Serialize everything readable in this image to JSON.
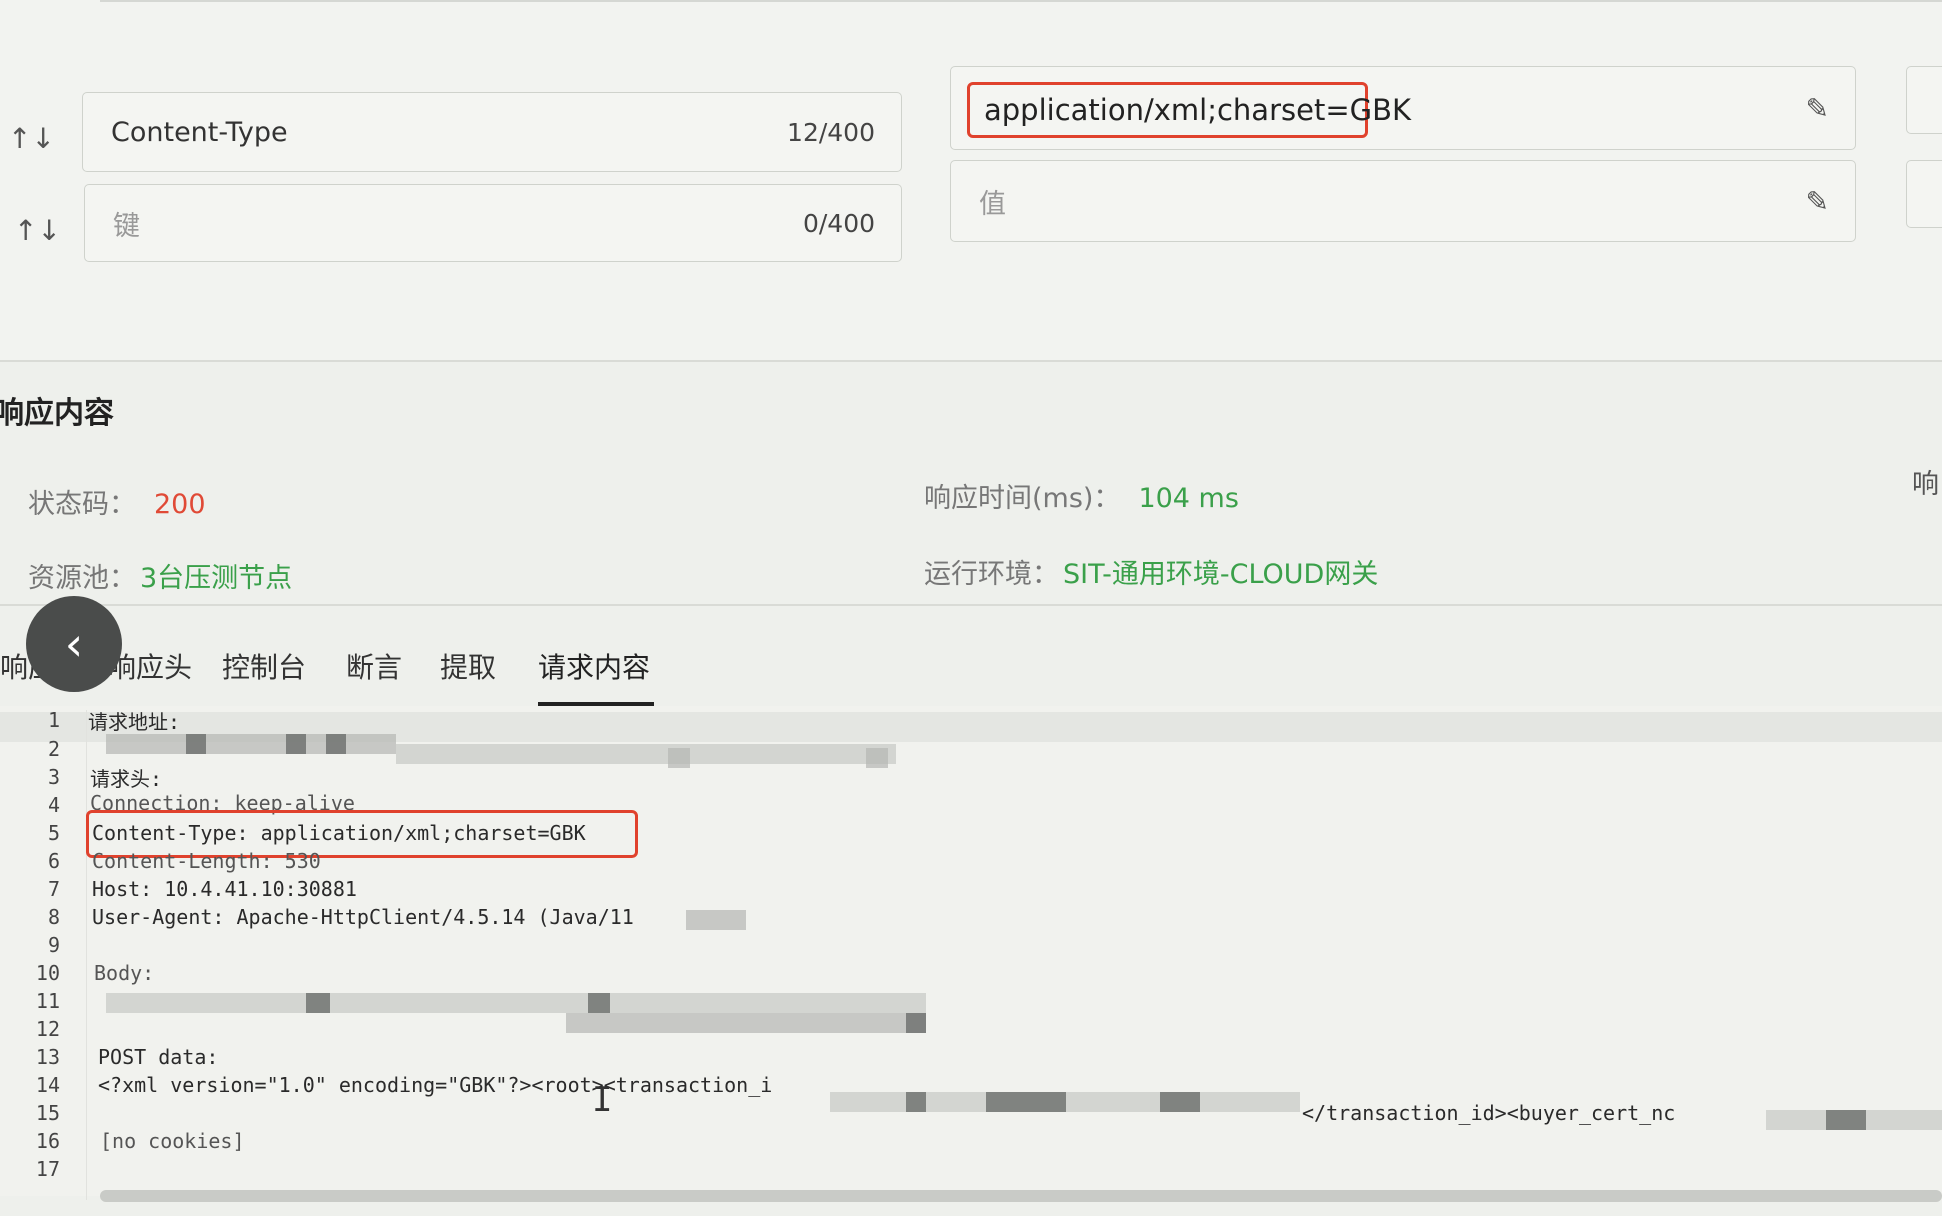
{
  "headers": {
    "rows": [
      {
        "key": "Content-Type",
        "key_count": "12/400",
        "value": "application/xml;charset=GBK"
      },
      {
        "key_placeholder": "键",
        "key_count": "0/400",
        "value_placeholder": "值"
      }
    ],
    "sort_arrows": "↑↓"
  },
  "response": {
    "section_title": "响应内容",
    "status_label": "状态码：",
    "status_value": "200",
    "time_label": "响应时间(ms)：",
    "time_value": "104 ms",
    "pool_label": "资源池：",
    "pool_value": "3台压测节点",
    "env_label": "运行环境：",
    "env_value": "SIT-通用环境-CLOUD网关",
    "right_edge_text": "响",
    "status_color": "#e04a36",
    "value_color": "#3aa04a"
  },
  "tabs": [
    {
      "label": "响应"
    },
    {
      "label": "响应头"
    },
    {
      "label": "控制台"
    },
    {
      "label": "断言"
    },
    {
      "label": "提取"
    },
    {
      "label": "请求内容",
      "active": true
    }
  ],
  "code": {
    "line_numbers": [
      "1",
      "2",
      "3",
      "4",
      "5",
      "6",
      "7",
      "8",
      "9",
      "10",
      "11",
      "12",
      "13",
      "14",
      "15",
      "16",
      "17"
    ],
    "lines": {
      "l1": "请求地址:",
      "l3": "请求头:",
      "l4": "Connection: keep-alive",
      "l5": "Content-Type: application/xml;charset=GBK",
      "l6": "Content-Length: 530",
      "l7": "Host: 10.4.41.10:30881",
      "l8": "User-Agent: Apache-HttpClient/4.5.14 (Java/11",
      "l10": "Body:",
      "l13": "POST data:",
      "l14a": "<?xml version=\"1.0\" encoding=\"GBK\"?><root><transaction_i",
      "l14b": "</transaction_id><buyer_cert_nc",
      "l16": "[no cookies]"
    }
  },
  "icons": {
    "edit": "✎",
    "back": "‹",
    "text_cursor": "I"
  },
  "highlight_color": "#e0422d"
}
